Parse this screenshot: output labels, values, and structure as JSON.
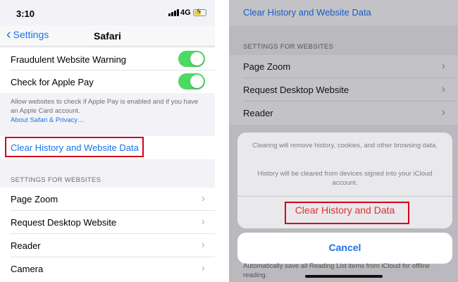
{
  "left": {
    "status": {
      "time": "3:10",
      "network": "4G"
    },
    "nav": {
      "back_label": "Settings",
      "title": "Safari"
    },
    "toggles": [
      {
        "label": "Fraudulent Website Warning",
        "on": true
      },
      {
        "label": "Check for Apple Pay",
        "on": true
      }
    ],
    "footnote": "Allow websites to check if Apple Pay is enabled and if you have an Apple Card account.",
    "footnote_link": "About Safari & Privacy…",
    "clear_button": "Clear History and Website Data",
    "section_header": "SETTINGS FOR WEBSITES",
    "website_settings": [
      "Page Zoom",
      "Request Desktop Website",
      "Reader",
      "Camera"
    ]
  },
  "right": {
    "top_link": "Clear History and Website Data",
    "section_header": "SETTINGS FOR WEBSITES",
    "website_settings": [
      "Page Zoom",
      "Request Desktop Website",
      "Reader"
    ],
    "sheet": {
      "message_1": "Clearing will remove history, cookies, and other browsing data.",
      "message_2": "History will be cleared from devices signed into your iCloud account.",
      "destructive_button": "Clear History and Data",
      "cancel_button": "Cancel"
    },
    "bottom_text": "Automatically save all Reading List items from iCloud for offline reading."
  },
  "colors": {
    "accent": "#1a73e8",
    "destructive": "#e0302c",
    "toggle_on": "#4cd964",
    "highlight_box": "#d0021b"
  }
}
